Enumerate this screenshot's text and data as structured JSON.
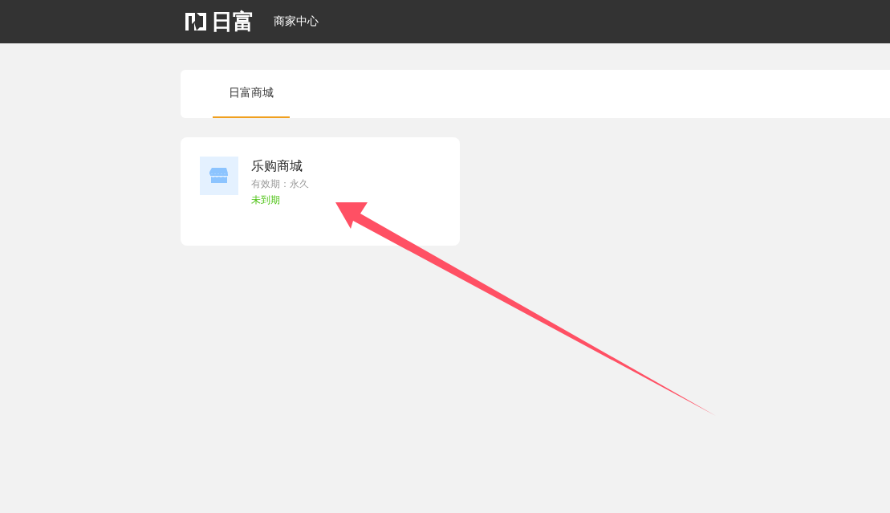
{
  "header": {
    "logo_text": "日富",
    "nav_label": "商家中心"
  },
  "tabs": [
    {
      "label": "日富商城",
      "selected": true
    }
  ],
  "stores": [
    {
      "name": "乐购商城",
      "validity": "有效期：永久",
      "status": "未到期",
      "expired": false
    }
  ]
}
